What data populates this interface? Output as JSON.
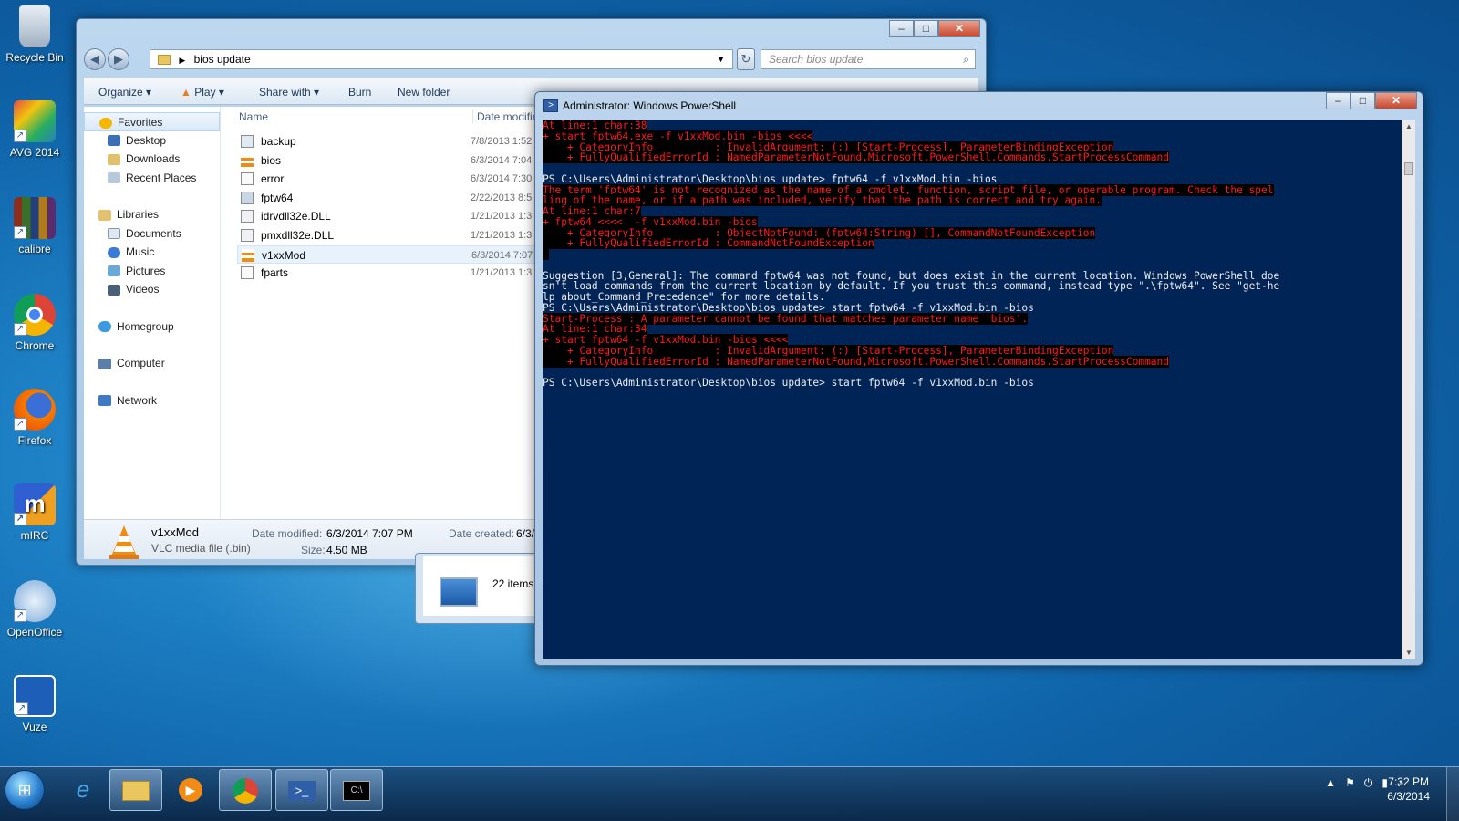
{
  "desktop": {
    "icons": [
      {
        "label": "Recycle Bin"
      },
      {
        "label": "AVG 2014"
      },
      {
        "label": "calibre"
      },
      {
        "label": "Chrome"
      },
      {
        "label": "Firefox"
      },
      {
        "label": "mIRC"
      },
      {
        "label": "OpenOffice"
      },
      {
        "label": "Vuze"
      }
    ]
  },
  "explorer": {
    "address": "bios update",
    "search_placeholder": "Search bios update",
    "toolbar": {
      "organize": "Organize",
      "play": "Play",
      "share_with": "Share with",
      "burn": "Burn",
      "new_folder": "New folder"
    },
    "nav": {
      "favorites": "Favorites",
      "desktop": "Desktop",
      "downloads": "Downloads",
      "recent_places": "Recent Places",
      "libraries": "Libraries",
      "documents": "Documents",
      "music": "Music",
      "pictures": "Pictures",
      "videos": "Videos",
      "homegroup": "Homegroup",
      "computer": "Computer",
      "network": "Network"
    },
    "columns": {
      "name": "Name",
      "date_modified": "Date modifie"
    },
    "files": [
      {
        "name": "backup",
        "date": "7/8/2013 1:52"
      },
      {
        "name": "bios",
        "date": "6/3/2014 7:04"
      },
      {
        "name": "error",
        "date": "6/3/2014 7:30"
      },
      {
        "name": "fptw64",
        "date": "2/22/2013 8:5"
      },
      {
        "name": "idrvdll32e.DLL",
        "date": "1/21/2013 1:3"
      },
      {
        "name": "pmxdll32e.DLL",
        "date": "1/21/2013 1:3"
      },
      {
        "name": "v1xxMod",
        "date": "6/3/2014 7:07"
      },
      {
        "name": "fparts",
        "date": "1/21/2013 1:3"
      }
    ],
    "details": {
      "name": "v1xxMod",
      "type": "VLC media file (.bin)",
      "date_modified_label": "Date modified:",
      "date_modified": "6/3/2014 7:07 PM",
      "size_label": "Size:",
      "size": "4.50 MB",
      "date_created_label": "Date created:",
      "date_created": "6/3/"
    }
  },
  "bg_window": {
    "items": "22 items"
  },
  "powershell": {
    "title": "Administrator: Windows PowerShell",
    "lines": [
      {
        "t": "At line:1 char:38",
        "err": true
      },
      {
        "t": "+ start fptw64.exe -f v1xxMod.bin -bios <<<<",
        "err": true
      },
      {
        "t": "    + CategoryInfo          : InvalidArgument: (:) [Start-Process], ParameterBindingException",
        "err": true
      },
      {
        "t": "    + FullyQualifiedErrorId : NamedParameterNotFound,Microsoft.PowerShell.Commands.StartProcessCommand",
        "err": true
      },
      {
        "t": "",
        "err": false
      },
      {
        "t": "PS C:\\Users\\Administrator\\Desktop\\bios update> fptw64 -f v1xxMod.bin -bios",
        "err": false
      },
      {
        "t": "The term 'fptw64' is not recognized as the name of a cmdlet, function, script file, or operable program. Check the spel",
        "err": true
      },
      {
        "t": "ling of the name, or if a path was included, verify that the path is correct and try again.",
        "err": true
      },
      {
        "t": "At line:1 char:7",
        "err": true
      },
      {
        "t": "+ fptw64 <<<<  -f v1xxMod.bin -bios",
        "err": true
      },
      {
        "t": "    + CategoryInfo          : ObjectNotFound: (fptw64:String) [], CommandNotFoundException",
        "err": true
      },
      {
        "t": "    + FullyQualifiedErrorId : CommandNotFoundException",
        "err": true
      },
      {
        "t": " ",
        "err": true
      },
      {
        "t": "",
        "err": false
      },
      {
        "t": "Suggestion [3,General]: The command fptw64 was not found, but does exist in the current location. Windows PowerShell doe",
        "err": false
      },
      {
        "t": "sn't load commands from the current location by default. If you trust this command, instead type \".\\fptw64\". See \"get-he",
        "err": false
      },
      {
        "t": "lp about_Command_Precedence\" for more details.",
        "err": false
      },
      {
        "t": "PS C:\\Users\\Administrator\\Desktop\\bios update> start fptw64 -f v1xxMod.bin -bios",
        "err": false
      },
      {
        "t": "Start-Process : A parameter cannot be found that matches parameter name 'bios'.",
        "err": true
      },
      {
        "t": "At line:1 char:34",
        "err": true
      },
      {
        "t": "+ start fptw64 -f v1xxMod.bin -bios <<<<",
        "err": true
      },
      {
        "t": "    + CategoryInfo          : InvalidArgument: (:) [Start-Process], ParameterBindingException",
        "err": true
      },
      {
        "t": "    + FullyQualifiedErrorId : NamedParameterNotFound,Microsoft.PowerShell.Commands.StartProcessCommand",
        "err": true
      },
      {
        "t": "",
        "err": false
      },
      {
        "t": "PS C:\\Users\\Administrator\\Desktop\\bios update> start fptw64 -f v1xxMod.bin -bios",
        "err": false
      }
    ]
  },
  "taskbar": {
    "time": "7:32 PM",
    "date": "6/3/2014"
  }
}
